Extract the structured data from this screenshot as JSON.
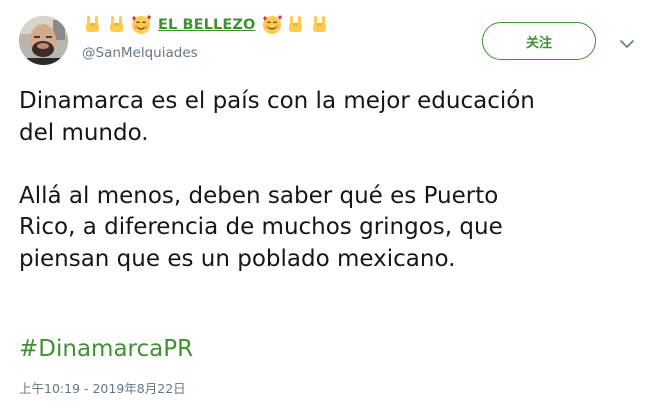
{
  "author": {
    "display_name": "EL BELLEZO",
    "username": "@SanMelquiades",
    "emojis_left": [
      "rock-on-hand",
      "rock-on-hand",
      "smiling-face-with-hearts"
    ],
    "emojis_right": [
      "smiling-face-with-hearts",
      "rock-on-hand",
      "rock-on-hand"
    ]
  },
  "follow_button": {
    "label": "关注"
  },
  "menu": {
    "icon": "chevron-down-icon"
  },
  "tweet": {
    "paragraph_1_line_1": "Dinamarca es el país con la mejor educación",
    "paragraph_1_line_2": "del mundo.",
    "paragraph_2_line_1": "Allá al menos, deben saber qué es Puerto",
    "paragraph_2_line_2": "Rico, a diferencia de muchos gringos, que",
    "paragraph_2_line_3": "piensan que es un poblado mexicano.",
    "hashtag": "#DinamarcaPR"
  },
  "timestamp": "上午10:19 - 2019年8月22日",
  "colors": {
    "accent": "#3f9132",
    "text": "#14171a",
    "secondary_text": "#657786"
  }
}
